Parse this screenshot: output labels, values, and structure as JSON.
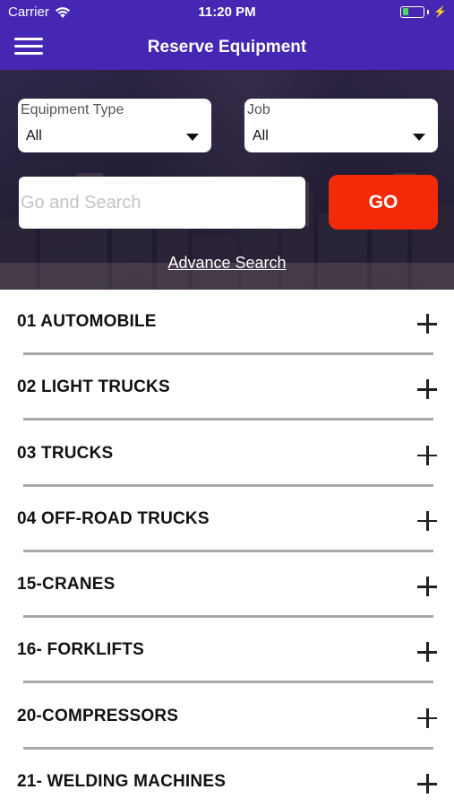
{
  "status_bar": {
    "carrier": "Carrier",
    "time": "11:20 PM",
    "battery_color": "#4cd964"
  },
  "header": {
    "title": "Reserve Equipment",
    "menu_icon": "hamburger-icon",
    "background": "#4527b4"
  },
  "filters": {
    "equipment_type": {
      "label": "Equipment Type",
      "value": "All"
    },
    "job": {
      "label": "Job",
      "value": "All"
    }
  },
  "search": {
    "placeholder": "Go and Search",
    "value": "",
    "go_label": "GO",
    "go_color": "#f22a08"
  },
  "advance_search": "Advance Search",
  "categories": [
    {
      "label": "01 AUTOMOBILE"
    },
    {
      "label": "02 LIGHT TRUCKS"
    },
    {
      "label": "03 TRUCKS"
    },
    {
      "label": "04 OFF-ROAD TRUCKS"
    },
    {
      "label": "15-CRANES"
    },
    {
      "label": "16- FORKLIFTS"
    },
    {
      "label": "20-COMPRESSORS"
    },
    {
      "label": "21- WELDING MACHINES"
    }
  ]
}
